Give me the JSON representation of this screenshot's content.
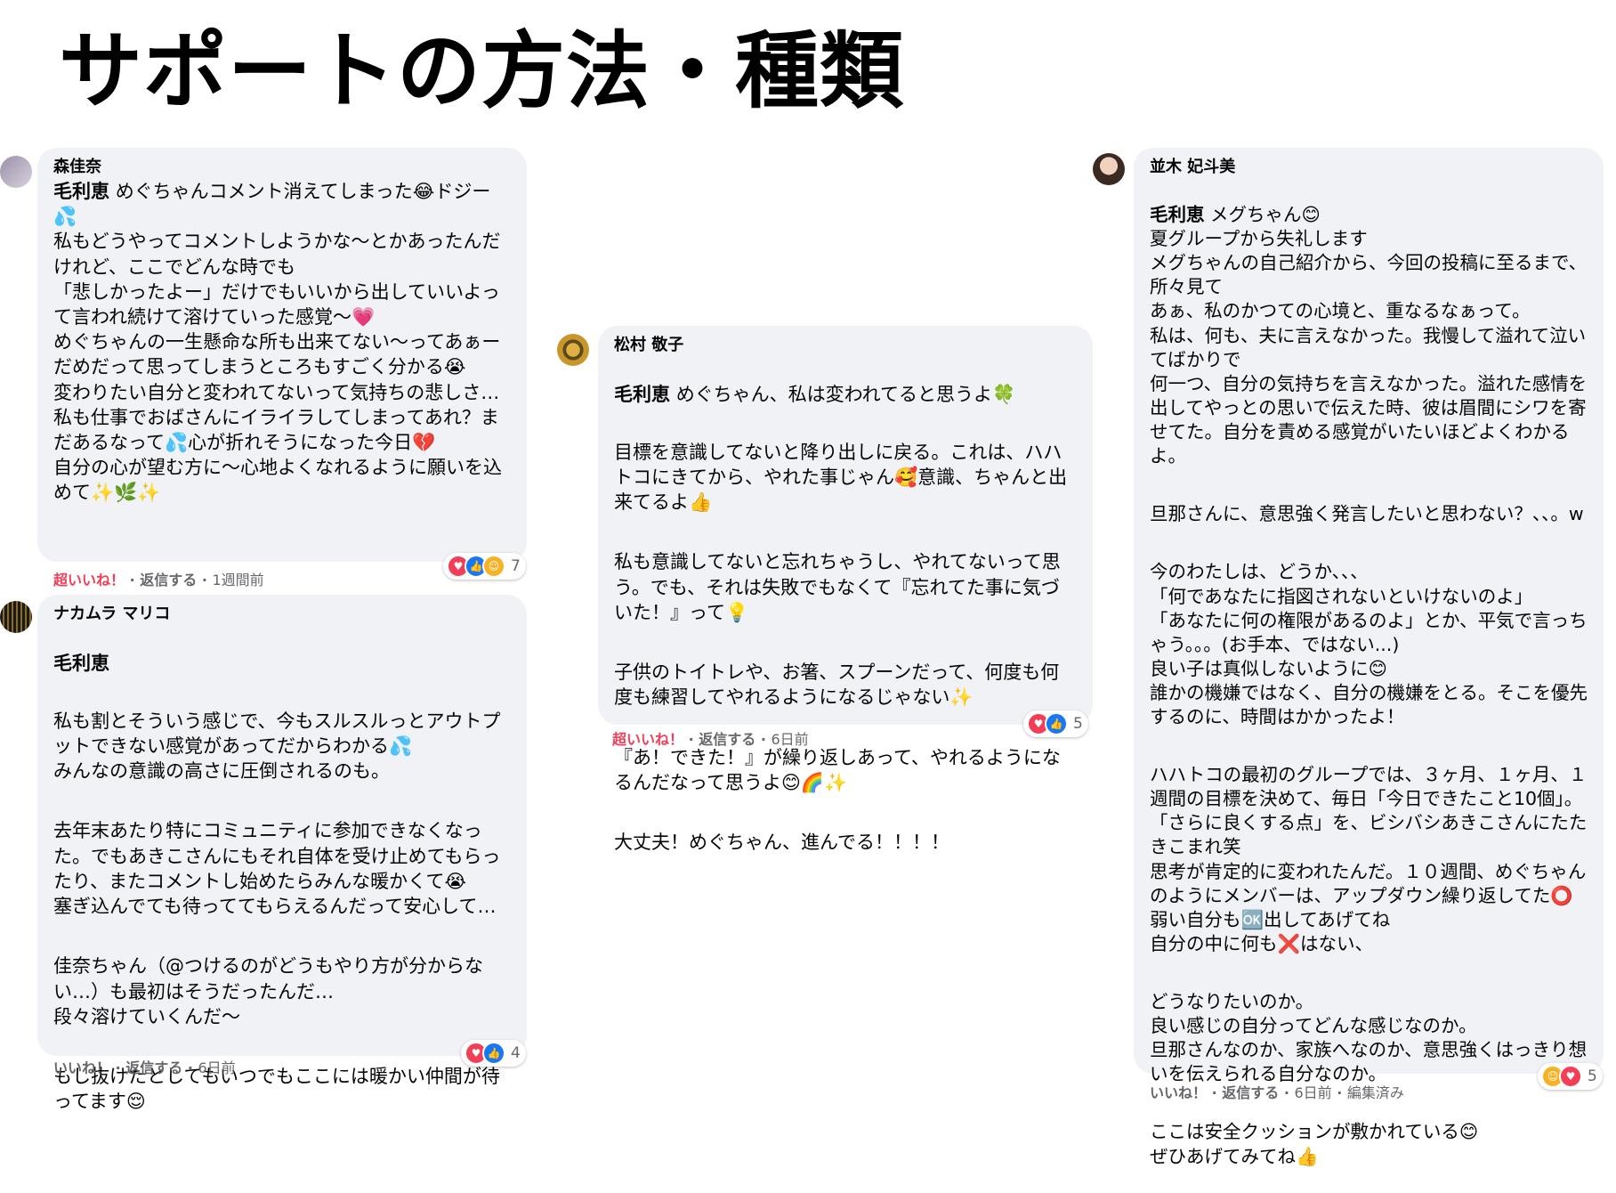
{
  "title": "サポートの方法・種類",
  "comments": [
    {
      "author": "森佳奈",
      "mention": "毛利恵",
      "paragraphs": [
        "めぐちゃんコメント消えてしまった😂ドジー💦\n私もどうやってコメントしようかな〜とかあったんだけれど、ここでどんな時でも\n「悲しかったよー」だけでもいいから出していいよって言われ続けて溶けていった感覚〜💗\nめぐちゃんの一生懸命な所も出来てない〜ってあぁーだめだって思ってしまうところもすごく分かる😭\n変わりたい自分と変われてないって気持ちの悲しさ…私も仕事でおばさんにイライラしてしまってあれ？まだあるなって💦心が折れそうになった今日💔\n自分の心が望む方に〜心地よくなれるように願いを込めて✨🌿✨"
      ],
      "like_label": "超いいね！",
      "reply_label": "返信する",
      "time": "1週間前",
      "reaction_count": "7",
      "reactions": [
        "love",
        "like",
        "care"
      ]
    },
    {
      "author": "ナカムラ マリコ",
      "mention": "毛利恵",
      "paragraphs": [
        "私も割とそういう感じで、今もスルスルっとアウトプットできない感覚があってだからわかる💦\nみんなの意識の高さに圧倒されるのも。",
        "去年末あたり特にコミュニティに参加できなくなった。でもあきこさんにもそれ自体を受け止めてもらったり、またコメントし始めたらみんな暖かくて😭\n塞ぎ込んでても待っててもらえるんだって安心して…",
        "佳奈ちゃん（@つけるのがどうもやり方が分からない…）も最初はそうだったんだ…\n段々溶けていくんだ〜",
        "もし抜けたとしてもいつでもここには暖かい仲間が待ってます😌"
      ],
      "like_label": "いいね！",
      "reply_label": "返信する",
      "time": "6日前",
      "reaction_count": "4",
      "reactions": [
        "love",
        "like"
      ]
    },
    {
      "author": "松村 敬子",
      "mention": "毛利恵",
      "mention_rest": "めぐちゃん、私は変われてると思うよ🍀",
      "paragraphs": [
        "目標を意識してないと降り出しに戻る。これは、ハハトコにきてから、やれた事じゃん🥰意識、ちゃんと出来てるよ👍",
        "私も意識してないと忘れちゃうし、やれてないって思う。でも、それは失敗でもなくて『忘れてた事に気づいた！』って💡",
        "子供のトイトレや、お箸、スプーンだって、何度も何度も練習してやれるようになるじゃない✨",
        "『あ！できた！』が繰り返しあって、やれるようになるんだなって思うよ😊🌈✨",
        "大丈夫！めぐちゃん、進んでる！！！！"
      ],
      "like_label": "超いいね！",
      "reply_label": "返信する",
      "time": "6日前",
      "reaction_count": "5",
      "reactions": [
        "love",
        "like"
      ]
    },
    {
      "author": "並木 妃斗美",
      "mention": "毛利恵",
      "paragraphs": [
        "メグちゃん😊\n夏グループから失礼します\nメグちゃんの自己紹介から、今回の投稿に至るまで、所々見て\nあぁ、私のかつての心境と、重なるなぁって。\n私は、何も、夫に言えなかった。我慢して溢れて泣いてばかりで\n何一つ、自分の気持ちを言えなかった。溢れた感情を出してやっとの思いで伝えた時、彼は眉間にシワを寄せてた。自分を責める感覚がいたいほどよくわかるよ。",
        "旦那さんに、意思強く発言したいと思わない？、、。w",
        "今のわたしは、どうか、、、\n「何であなたに指図されないといけないのよ」\n「あなたに何の権限があるのよ」とか、平気で言っちゃう。。。(お手本、ではない...)\n良い子は真似しないように😊\n誰かの機嫌ではなく、自分の機嫌をとる。そこを優先するのに、時間はかかったよ！",
        "ハハトコの最初のグループでは、３ヶ月、１ヶ月、１週間の目標を決めて、毎日「今日できたこと10個」。「さらに良くする点」を、ビシバシあきこさんにたたきこまれ笑\n思考が肯定的に変われたんだ。１０週間、めぐちゃんのようにメンバーは、アップダウン繰り返してた⭕\n弱い自分も🆗出してあげてね\n自分の中に何も❌はない、",
        "どうなりたいのか。\n良い感じの自分ってどんな感じなのか。\n旦那さんなのか、家族へなのか、意思強くはっきり想いを伝えられる自分なのか。",
        "ここは安全クッションが敷かれている😊\nぜひあげてみてね👍"
      ],
      "like_label": "いいね！",
      "reply_label": "返信する",
      "time": "6日前",
      "edited_label": "編集済み",
      "reaction_count": "5",
      "reactions": [
        "care",
        "love"
      ]
    }
  ]
}
